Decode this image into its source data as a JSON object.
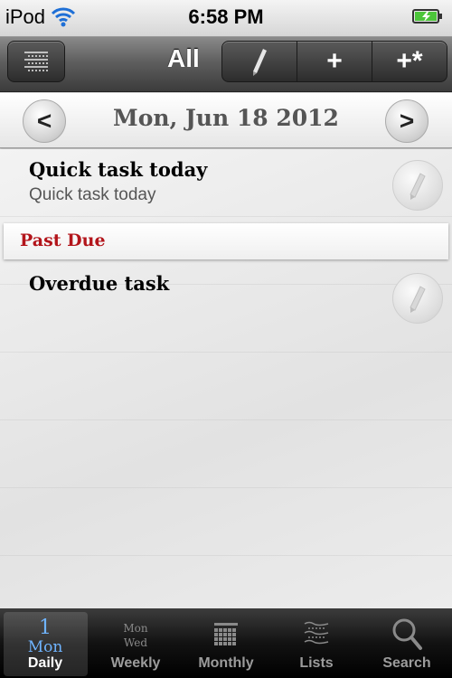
{
  "status_bar": {
    "carrier": "iPod",
    "time": "6:58 PM"
  },
  "toolbar": {
    "title": "All",
    "add_label": "+",
    "add_special_label": "+*"
  },
  "date_header": {
    "date": "Mon, Jun 18 2012",
    "prev_label": "<",
    "next_label": ">"
  },
  "tasks": [
    {
      "title": "Quick task today",
      "subtitle": "Quick task today"
    }
  ],
  "past_due": {
    "section_label": "Past Due",
    "tasks": [
      {
        "title": "Overdue task"
      }
    ]
  },
  "tab_bar": {
    "daily_icon": {
      "day": "1",
      "weekday": "Mon"
    },
    "weekly_icon": {
      "line1": "Mon",
      "line2": "Wed"
    },
    "tabs": [
      {
        "label": "Daily",
        "icon": "daily-calendar-icon",
        "active": true
      },
      {
        "label": "Weekly",
        "icon": "weekly-icon",
        "active": false
      },
      {
        "label": "Monthly",
        "icon": "monthly-grid-icon",
        "active": false
      },
      {
        "label": "Lists",
        "icon": "lists-icon",
        "active": false
      },
      {
        "label": "Search",
        "icon": "search-icon",
        "active": false
      }
    ]
  },
  "colors": {
    "past_due": "#b3151b",
    "active_tab_icon": "#6fb4ff"
  }
}
